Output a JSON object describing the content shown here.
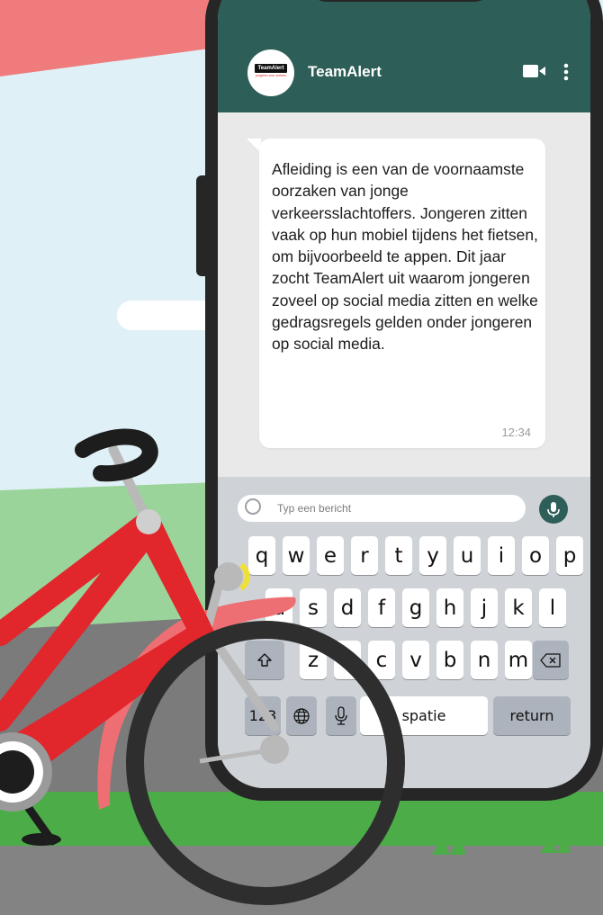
{
  "chat": {
    "contact_name": "TeamAlert",
    "logo_text": "TeamAlert",
    "logo_tagline": "jongeren voor verkeer",
    "message_text": "Afleiding is een van de voornaamste oorzaken van jonge verkeersslachtoffers. Jongeren zitten vaak op hun mobiel tijdens het fietsen, om bijvoorbeeld te appen. Dit jaar zocht TeamAlert uit waarom jongeren zoveel op social media zitten en welke gedragsregels gelden onder jongeren op social media.",
    "message_time": "12:34",
    "input_placeholder": "Typ een bericht"
  },
  "header_icons": [
    "video-call-icon",
    "more-options-icon"
  ],
  "keyboard": {
    "row1": [
      "q",
      "w",
      "e",
      "r",
      "t",
      "y",
      "u",
      "i",
      "o",
      "p"
    ],
    "row2": [
      "a",
      "s",
      "d",
      "f",
      "g",
      "h",
      "j",
      "k",
      "l"
    ],
    "row3": [
      "z",
      "x",
      "c",
      "v",
      "b",
      "n",
      "m"
    ],
    "shift_icon": "shift-icon",
    "backspace_icon": "backspace-icon",
    "numbers_label": "123",
    "globe_icon": "globe-icon",
    "mic_icon": "microphone-icon",
    "space_label": "spatie",
    "return_label": "return"
  },
  "colors": {
    "header": "#2d5e57",
    "bike_frame": "#e1262c",
    "fender": "#ee6f73",
    "grass": "#4bac48",
    "sky": "#dff0f6",
    "banner": "#ef7b7c"
  }
}
